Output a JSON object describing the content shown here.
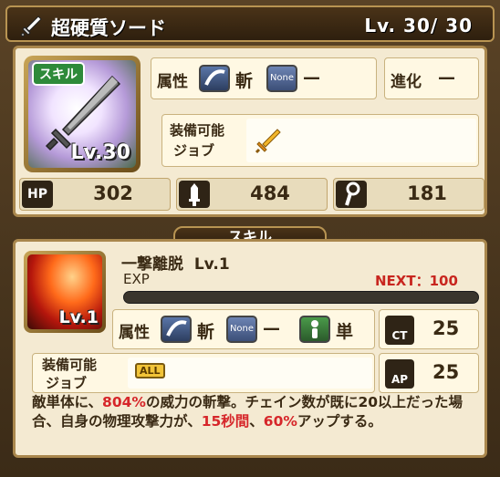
{
  "title": {
    "name": "超硬質ソード",
    "level": "Lv.  30/  30"
  },
  "item": {
    "badge": "スキル",
    "level": "Lv.30"
  },
  "attributes": {
    "attr_label": "属性",
    "attr_value": "斬",
    "none_icon_text": "None",
    "none_value": "—",
    "evolve_label": "進化",
    "evolve_value": "—",
    "equip_label_line1": "装備可能",
    "equip_label_line2": "ジョブ"
  },
  "stats": {
    "hp_label": "HP",
    "hp": "302",
    "attack": "484",
    "magic": "181"
  },
  "skill": {
    "section_label": "スキル",
    "name": "一撃離脱",
    "level": "Lv.1",
    "exp_label": "EXP",
    "next_label": "NEXT：100",
    "exp_progress": 0,
    "icon_level": "Lv.1",
    "attr_label": "属性",
    "attr_value": "斬",
    "none_icon_text": "None",
    "none_value": "—",
    "target_value": "単",
    "ct_label": "CT",
    "ct_value": "25",
    "ap_label": "AP",
    "ap_value": "25",
    "equip_label_line1": "装備可能",
    "equip_label_line2": "ジョブ",
    "all_badge": "ALL",
    "desc_part1": "敵単体に、",
    "desc_pct": "804%",
    "desc_part2": "の威力の斬撃。チェイン数が既に20以上だった場合、自身の物理攻撃力が、",
    "desc_turns": "15秒間",
    "desc_part3": "、",
    "desc_buff": "60%",
    "desc_part4": "アップする。"
  }
}
